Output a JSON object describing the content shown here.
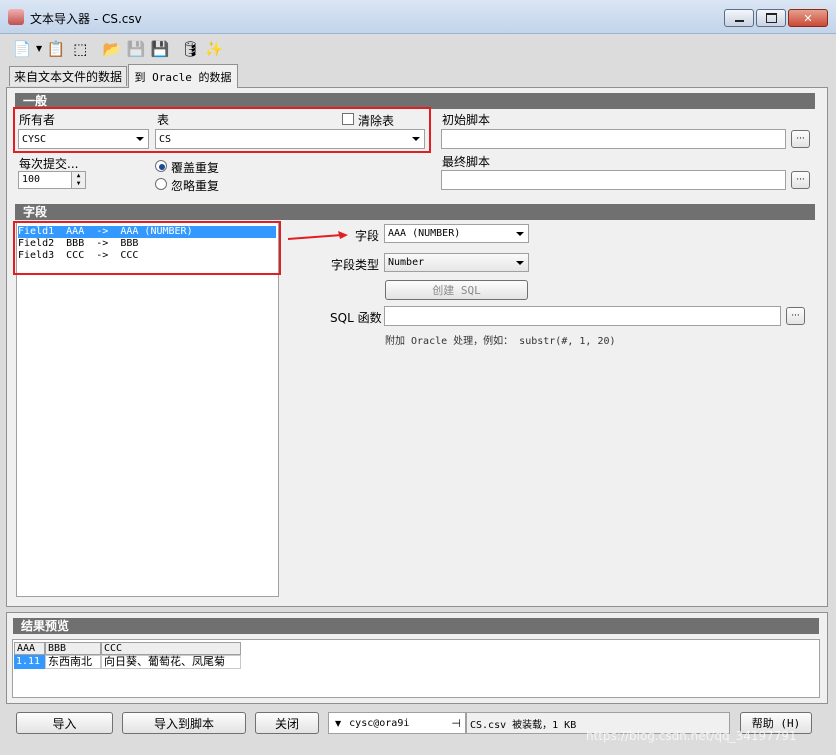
{
  "window": {
    "title": "文本导入器 - CS.csv"
  },
  "tabs": [
    {
      "label": "来自文本文件的数据"
    },
    {
      "label": "到 Oracle 的数据"
    }
  ],
  "general": {
    "header": "一般",
    "owner_label": "所有者",
    "owner_value": "CYSC",
    "table_label": "表",
    "table_value": "CS",
    "clear_table_label": "清除表",
    "commit_label": "每次提交...",
    "commit_value": "100",
    "overwrite_label": "覆盖重复",
    "ignore_label": "忽略重复",
    "init_script_label": "初始脚本",
    "final_script_label": "最终脚本"
  },
  "fields": {
    "header": "字段",
    "list": [
      "Field1  AAA  ->  AAA (NUMBER)",
      "Field2  BBB  ->  BBB",
      "Field3  CCC  ->  CCC"
    ],
    "field_label": "字段",
    "field_value": "AAA (NUMBER)",
    "type_label": "字段类型",
    "type_value": "Number",
    "create_sql_label": "创建 SQL",
    "sql_func_label": "SQL 函数",
    "hint": "附加 Oracle 处理，例如： substr(#, 1, 20)"
  },
  "preview": {
    "header": "结果预览",
    "columns": [
      "AAA",
      "BBB",
      "CCC"
    ],
    "rows": [
      [
        "1.11",
        "东西南北",
        "向日葵、葡萄花、凤尾菊"
      ]
    ]
  },
  "bottom": {
    "import_label": "导入",
    "import_script_label": "导入到脚本",
    "close_label": "关闭",
    "connection": "cysc@ora9i",
    "status": "CS.csv 被装载，1 KB",
    "help_label": "帮助 (H)",
    "watermark": "https://blog.csdn.net/qq_34197791"
  },
  "colors": {
    "section": "#707070",
    "highlight": "#3399ff",
    "red": "#e02020"
  }
}
